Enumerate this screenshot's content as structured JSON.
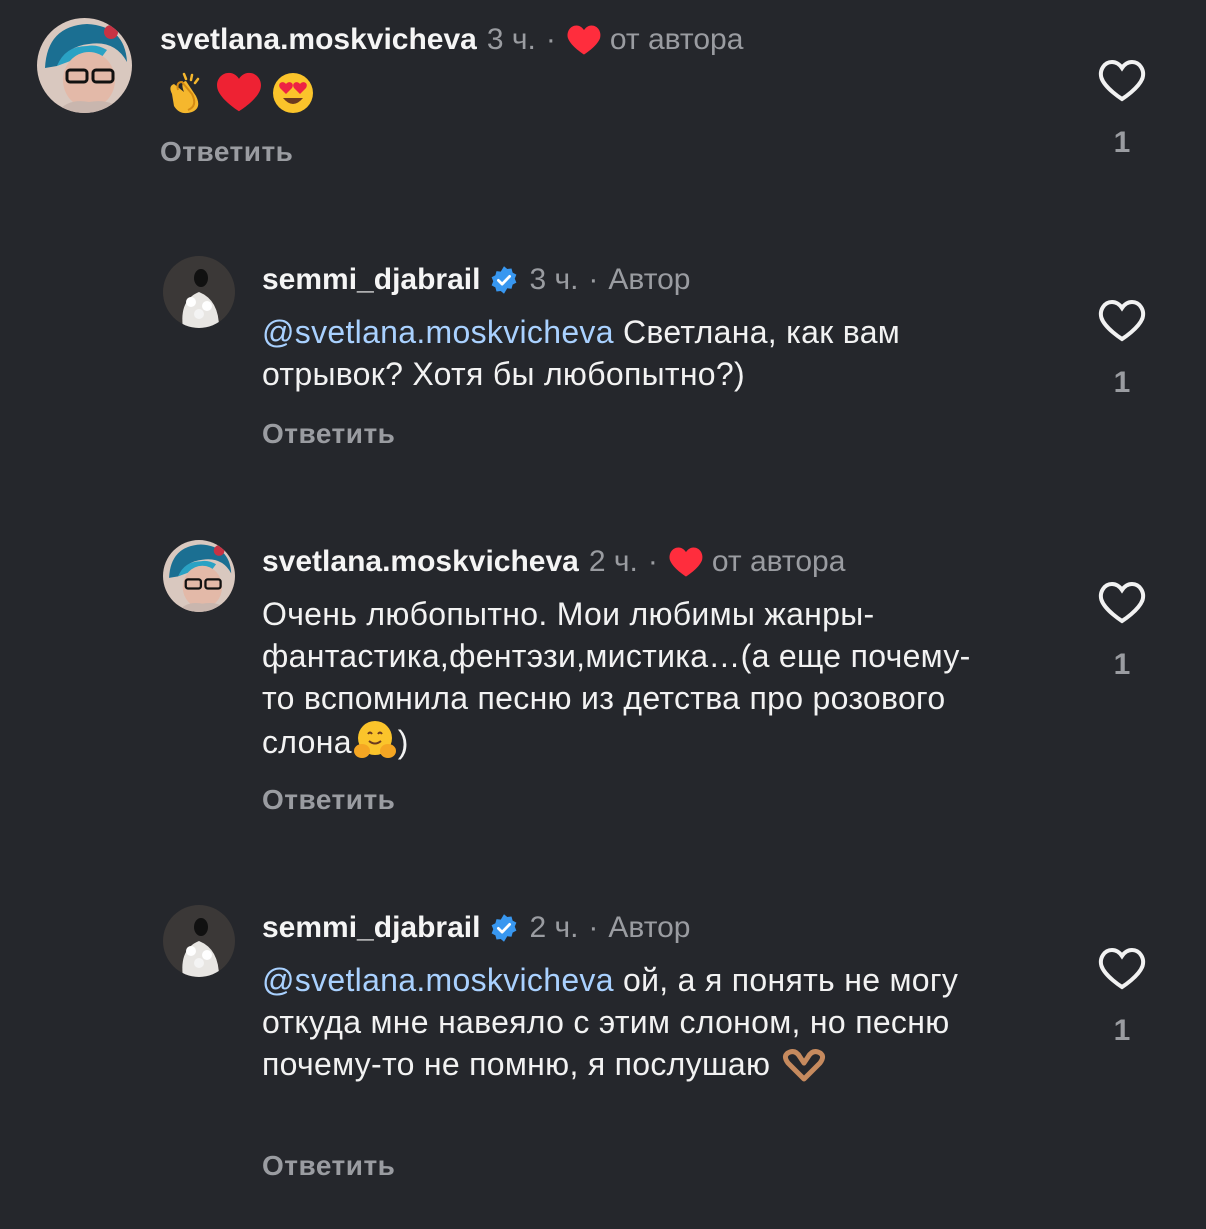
{
  "comments": [
    {
      "username": "svetlana.moskvicheva",
      "time": "3 ч.",
      "tag": "от автора",
      "liked_by_author": true,
      "verified": false,
      "text": "",
      "emojis": [
        "clapping-hands-emoji",
        "red-heart-emoji",
        "heart-eyes-emoji"
      ],
      "reply_label": "Ответить",
      "likes": "1"
    },
    {
      "username": "semmi_djabrail",
      "time": "3 ч.",
      "tag": "Автор",
      "liked_by_author": false,
      "verified": true,
      "mention": "@svetlana.moskvicheva",
      "text": " Светлана, как вам отрывок? Хотя бы любопытно?)",
      "reply_label": "Ответить",
      "likes": "1"
    },
    {
      "username": "svetlana.moskvicheva",
      "time": "2 ч.",
      "tag": "от автора",
      "liked_by_author": true,
      "verified": false,
      "text": "Очень любопытно. Мои любимы жанры-фантастика,фентэзи,мистика…(а еще почему-то вспомнила песню из детства про розового слона",
      "text_end": ")",
      "reply_label": "Ответить",
      "likes": "1"
    },
    {
      "username": "semmi_djabrail",
      "time": "2 ч.",
      "tag": "Автор",
      "liked_by_author": false,
      "verified": true,
      "mention": "@svetlana.moskvicheva",
      "text": " ой, а я понять не могу откуда мне навеяло с этим слоном, но песню почему-то не помню, я послушаю ",
      "reply_label": "Ответить",
      "likes": "1"
    }
  ],
  "colors": {
    "background": "#25272c",
    "mention": "#a9d1ff",
    "secondary_text": "#9a9ca1",
    "heart_red": "#ff2d3d",
    "verified_blue": "#3897f0"
  }
}
